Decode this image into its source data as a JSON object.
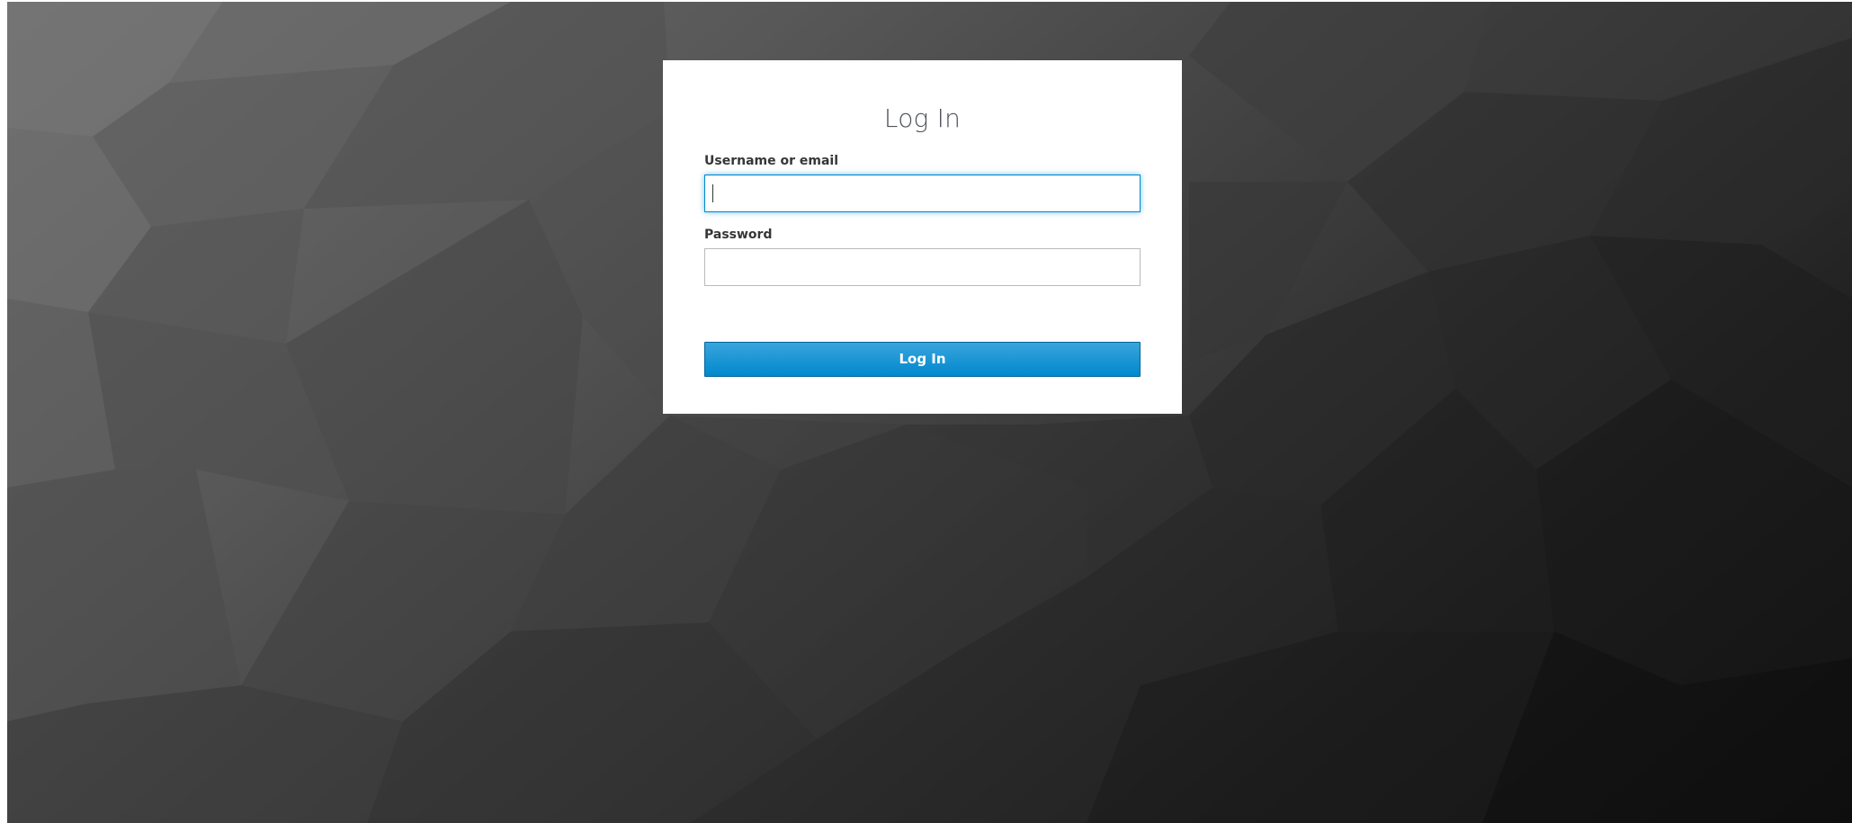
{
  "page": {
    "background_colors": [
      "#6e6e6e",
      "#3c3c3c",
      "#111111"
    ]
  },
  "login": {
    "title": "Log In",
    "username_label": "Username or email",
    "username_value": "",
    "password_label": "Password",
    "password_value": "",
    "submit_label": "Log In",
    "accent_color": "#0088ce"
  }
}
